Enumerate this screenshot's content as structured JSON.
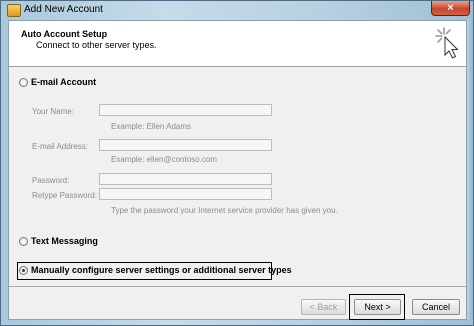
{
  "window": {
    "title": "Add New Account",
    "close_label": "×"
  },
  "header": {
    "title": "Auto Account Setup",
    "subtitle": "Connect to other server types."
  },
  "options": {
    "email": {
      "label": "E-mail Account",
      "selected": false
    },
    "text_messaging": {
      "label": "Text Messaging",
      "selected": false
    },
    "manual": {
      "label": "Manually configure server settings or additional server types",
      "selected": true
    }
  },
  "email_form": {
    "name_label": "Your Name:",
    "name_value": "",
    "name_example": "Example: Ellen Adams",
    "email_label": "E-mail Address:",
    "email_value": "",
    "email_example": "Example: ellen@contoso.com",
    "password_label": "Password:",
    "password_value": "",
    "retype_label": "Retype Password:",
    "retype_value": "",
    "password_hint": "Type the password your Internet service provider has given you."
  },
  "buttons": {
    "back": "< Back",
    "next": "Next >",
    "cancel": "Cancel"
  },
  "icons": {
    "app": "mail-icon",
    "wizard": "sparkle-cursor-icon"
  }
}
